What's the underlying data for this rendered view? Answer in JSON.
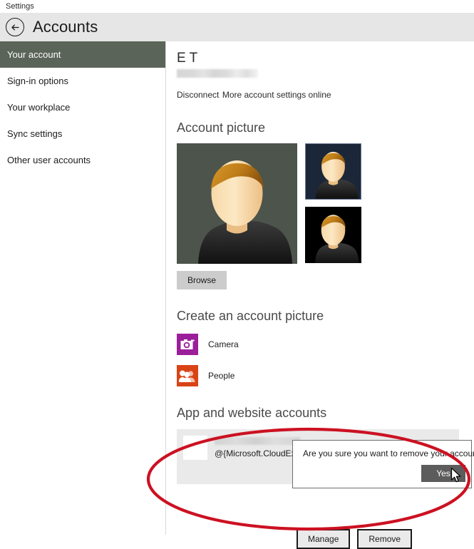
{
  "window": {
    "title": "Settings"
  },
  "header": {
    "back_icon": "back-arrow-icon",
    "title": "Accounts"
  },
  "sidebar": {
    "items": [
      {
        "label": "Your account",
        "selected": true
      },
      {
        "label": "Sign-in options",
        "selected": false
      },
      {
        "label": "Your workplace",
        "selected": false
      },
      {
        "label": "Sync settings",
        "selected": false
      },
      {
        "label": "Other user accounts",
        "selected": false
      }
    ]
  },
  "account": {
    "display_name": "E T",
    "email_redacted": "",
    "disconnect_label": "Disconnect",
    "more_settings_label": "More account settings online"
  },
  "account_picture": {
    "section_title": "Account picture",
    "browse_label": "Browse",
    "thumbnails": [
      {
        "name": "current-picture",
        "background": "#4c544b"
      },
      {
        "name": "recent-picture-1",
        "background": "#1b2639"
      },
      {
        "name": "recent-picture-2",
        "background": "#000000"
      }
    ]
  },
  "create_picture": {
    "section_title": "Create an account picture",
    "apps": [
      {
        "label": "Camera",
        "icon": "camera-icon",
        "color": "#9b1f9b"
      },
      {
        "label": "People",
        "icon": "people-icon",
        "color": "#d94316"
      }
    ]
  },
  "app_accounts": {
    "section_title": "App and website accounts",
    "entry": {
      "name_redacted": "",
      "package": "@{Microsoft.CloudExperi"
    },
    "manage_label": "Manage",
    "remove_label": "Remove"
  },
  "dialog": {
    "message": "Are you sure you want to remove your account?",
    "yes_label": "Yes"
  },
  "annotation": {
    "shape": "ellipse",
    "color": "#cc1122"
  },
  "colors": {
    "sidebar_selected": "#5b6459",
    "header_bg": "#e6e6e6",
    "row_bg": "#eaeaea",
    "dialog_button": "#5c5c5c",
    "annotation_red": "#cc1122"
  }
}
